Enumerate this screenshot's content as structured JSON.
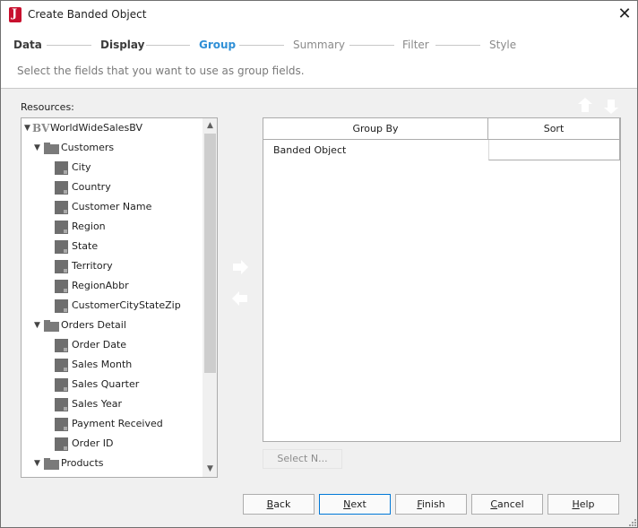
{
  "window": {
    "title": "Create Banded Object"
  },
  "steps": [
    "Data",
    "Display",
    "Group",
    "Summary",
    "Filter",
    "Style"
  ],
  "instruction": "Select the fields that you want to use as group fields.",
  "resources_label": "Resources:",
  "tree": {
    "root": "WorldWideSalesBV",
    "folders": [
      {
        "label": "Customers",
        "fields": [
          "City",
          "Country",
          "Customer Name",
          "Region",
          "State",
          "Territory",
          "RegionAbbr",
          "CustomerCityStateZip"
        ]
      },
      {
        "label": "Orders Detail",
        "fields": [
          "Order Date",
          "Sales Month",
          "Sales Quarter",
          "Sales Year",
          "Payment Received",
          "Order ID"
        ]
      },
      {
        "label": "Products",
        "fields": []
      }
    ]
  },
  "table": {
    "headers": {
      "group_by": "Group By",
      "sort": "Sort"
    },
    "rows": [
      {
        "name": "Banded Object",
        "sort": ""
      }
    ]
  },
  "select_n_label": "Select N...",
  "buttons": {
    "back": {
      "mnemonic": "B",
      "rest": "ack"
    },
    "next": {
      "mnemonic": "N",
      "rest": "ext"
    },
    "finish": {
      "mnemonic": "F",
      "rest": "inish"
    },
    "cancel": {
      "mnemonic": "C",
      "rest": "ancel"
    },
    "help": {
      "mnemonic": "H",
      "rest": "elp"
    }
  },
  "colors": {
    "current_step": "#2f8fd6",
    "accent_button_border": "#0078d7",
    "app_icon": "#c8102e"
  }
}
